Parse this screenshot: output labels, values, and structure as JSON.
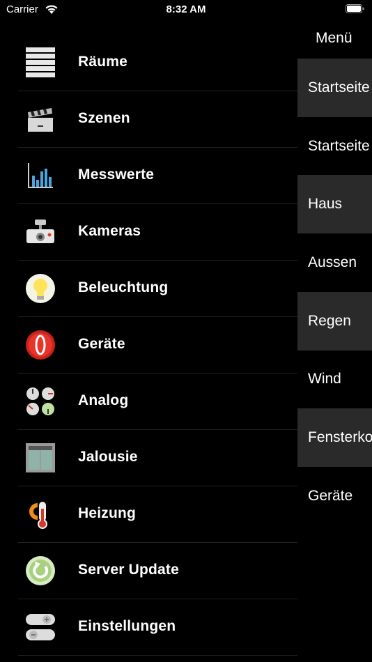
{
  "status_bar": {
    "carrier": "Carrier",
    "time": "8:32 AM"
  },
  "menu": {
    "items": [
      {
        "label": "Räume",
        "icon": "rooms-list-icon"
      },
      {
        "label": "Szenen",
        "icon": "clapperboard-icon"
      },
      {
        "label": "Messwerte",
        "icon": "bar-chart-icon"
      },
      {
        "label": "Kameras",
        "icon": "camera-icon"
      },
      {
        "label": "Beleuchtung",
        "icon": "lightbulb-icon"
      },
      {
        "label": "Geräte",
        "icon": "power-device-icon"
      },
      {
        "label": "Analog",
        "icon": "analog-gauges-icon"
      },
      {
        "label": "Jalousie",
        "icon": "window-blind-icon"
      },
      {
        "label": "Heizung",
        "icon": "thermometer-icon"
      },
      {
        "label": "Server Update",
        "icon": "refresh-update-icon"
      },
      {
        "label": "Einstellungen",
        "icon": "toggle-switches-icon"
      }
    ]
  },
  "side_panel": {
    "title": "Menü",
    "items": [
      {
        "label": "Startseite",
        "highlighted": true
      },
      {
        "label": "Startseite",
        "highlighted": false
      },
      {
        "label": "Haus",
        "highlighted": true
      },
      {
        "label": "Aussen",
        "highlighted": false
      },
      {
        "label": "Regen",
        "highlighted": true
      },
      {
        "label": "Wind",
        "highlighted": false
      },
      {
        "label": "Fensterkontakte",
        "highlighted": true
      },
      {
        "label": "Geräte",
        "highlighted": false
      }
    ]
  },
  "colors": {
    "background": "#000000",
    "highlight": "#2a2a2a",
    "separator": "#202020"
  }
}
